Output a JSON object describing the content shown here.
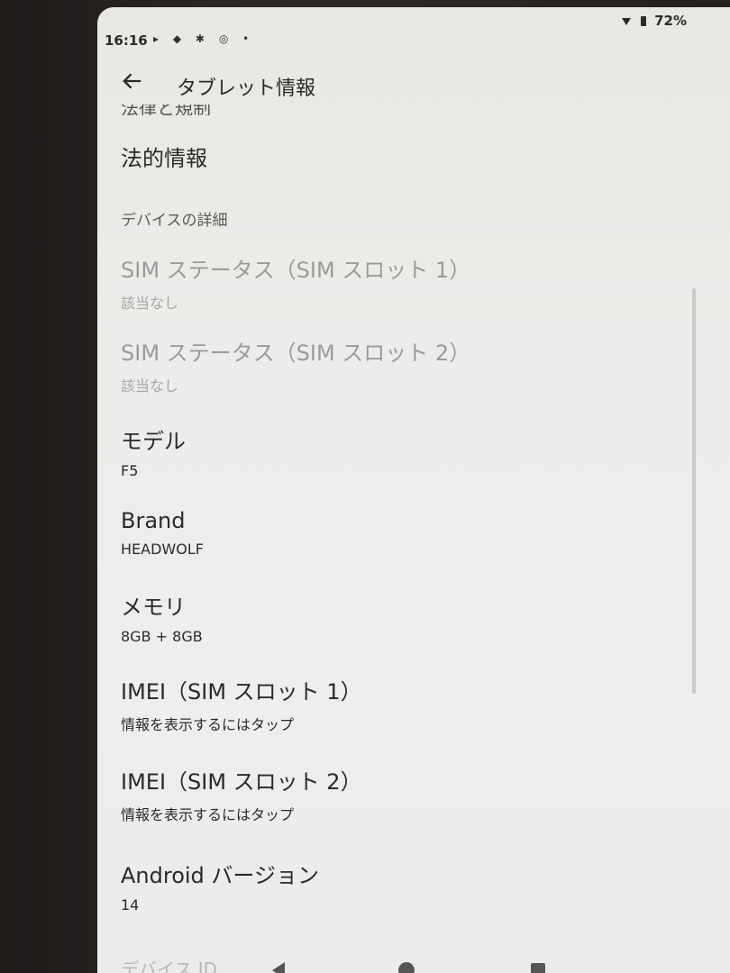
{
  "status": {
    "time": "16:16",
    "battery": "72%",
    "notification_icons": [
      "media-icon",
      "dropbox-icon",
      "slack-icon",
      "instagram-icon",
      "dot-icon"
    ]
  },
  "app_bar": {
    "title": "タブレット情報"
  },
  "section_header": "デバイスの詳細",
  "items": [
    {
      "title": "法的情報"
    },
    {
      "title": "SIM ステータス（SIM スロット 1）",
      "subtitle": "該当なし"
    },
    {
      "title": "SIM ステータス（SIM スロット 2）",
      "subtitle": "該当なし"
    },
    {
      "title": "モデル",
      "subtitle": "F5"
    },
    {
      "title": "Brand",
      "subtitle": "HEADWOLF"
    },
    {
      "title": "メモリ",
      "subtitle": "8GB + 8GB"
    },
    {
      "title": "IMEI（SIM スロット 1）",
      "subtitle": "情報を表示するにはタップ"
    },
    {
      "title": "IMEI（SIM スロット 2）",
      "subtitle": "情報を表示するにはタップ"
    },
    {
      "title": "Android バージョン",
      "subtitle": "14"
    }
  ],
  "cut_top": "法律と規制",
  "cut_bottom": "デバイス ID",
  "colors": {
    "screen_bg": "#ecedea",
    "text": "#2a2a2a",
    "disabled": "#9a9b9a"
  }
}
